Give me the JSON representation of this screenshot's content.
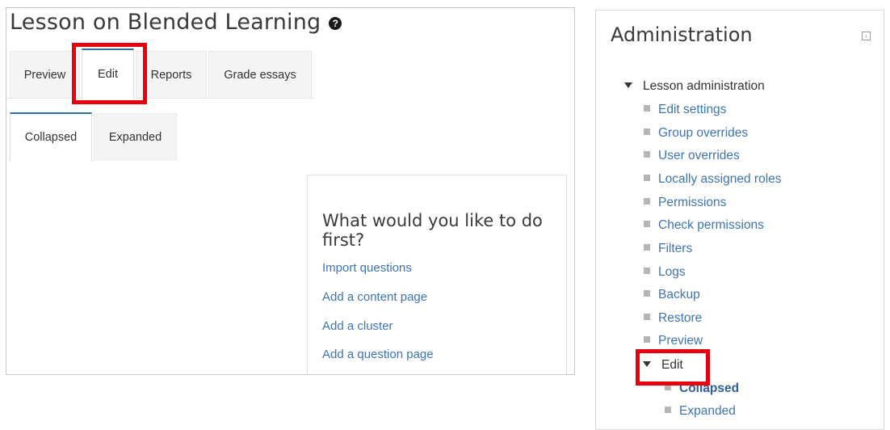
{
  "lesson": {
    "title": "Lesson on Blended Learning",
    "help_icon": "question-circle-icon",
    "tabs": [
      {
        "label": "Preview",
        "active": false
      },
      {
        "label": "Edit",
        "active": true
      },
      {
        "label": "Reports",
        "active": false
      },
      {
        "label": "Grade essays",
        "active": false
      }
    ],
    "subtabs": [
      {
        "label": "Collapsed",
        "active": true
      },
      {
        "label": "Expanded",
        "active": false
      }
    ],
    "first_card": {
      "heading": "What would you like to do first?",
      "actions": [
        "Import questions",
        "Add a content page",
        "Add a cluster",
        "Add a question page"
      ]
    }
  },
  "administration": {
    "title": "Administration",
    "dock_icon": "dock-block-icon",
    "section": "Lesson administration",
    "items": [
      "Edit settings",
      "Group overrides",
      "User overrides",
      "Locally assigned roles",
      "Permissions",
      "Check permissions",
      "Filters",
      "Logs",
      "Backup",
      "Restore",
      "Preview"
    ],
    "edit_node": {
      "label": "Edit",
      "children": [
        {
          "label": "Collapsed",
          "current": true
        },
        {
          "label": "Expanded",
          "current": false
        }
      ]
    }
  },
  "colors": {
    "highlight_box": "#e8000f",
    "link": "#3d74b5",
    "active_tab_border": "#2f6ea5"
  }
}
